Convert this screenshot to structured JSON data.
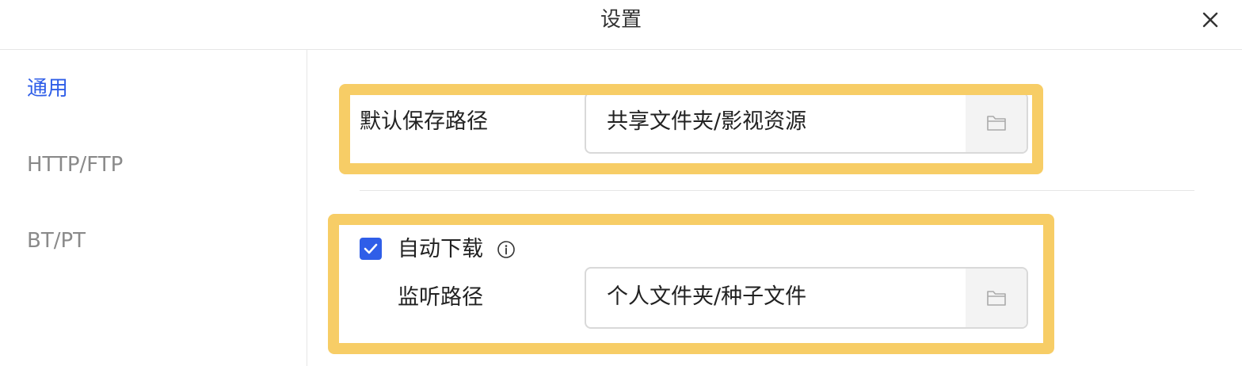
{
  "dialog": {
    "title": "设置",
    "close_icon": "close-icon"
  },
  "sidebar": {
    "items": [
      {
        "label": "通用",
        "active": true
      },
      {
        "label": "HTTP/FTP",
        "active": false
      },
      {
        "label": "BT/PT",
        "active": false
      }
    ]
  },
  "general": {
    "default_path": {
      "label": "默认保存路径",
      "value": "共享文件夹/影视资源",
      "button_icon": "folder-icon"
    },
    "auto_download": {
      "label": "自动下载",
      "checked": true,
      "info_icon": "info-icon"
    },
    "watch_path": {
      "label": "监听路径",
      "value": "个人文件夹/种子文件",
      "button_icon": "folder-icon"
    }
  },
  "colors": {
    "accent": "#2f5ee8",
    "highlight": "#f7cd66",
    "border": "#d9d9d9"
  }
}
